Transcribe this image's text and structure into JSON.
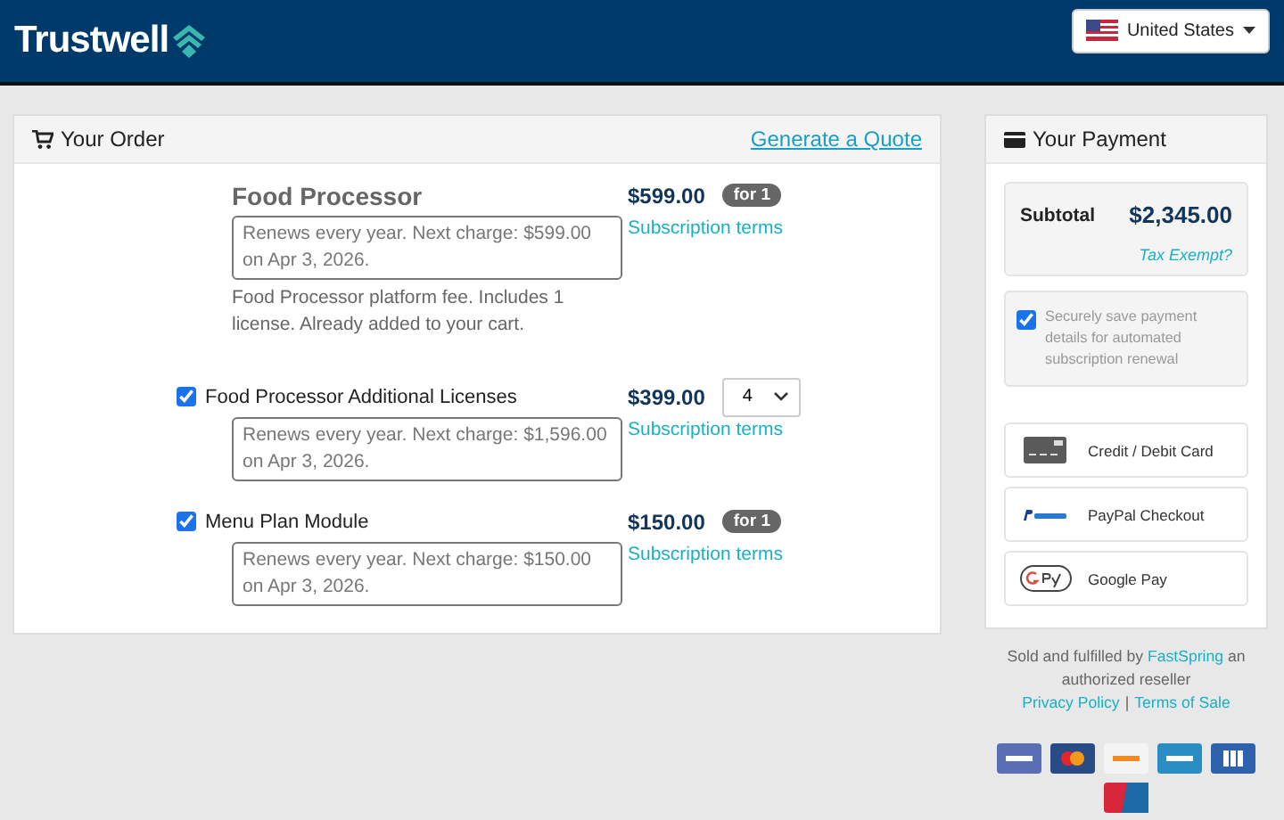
{
  "header": {
    "logo": "Trustwell",
    "country": "United States"
  },
  "order": {
    "title": "Your Order",
    "quote_link": "Generate a Quote",
    "items": [
      {
        "kind": "base",
        "name": "Food Processor",
        "renewal": "Renews every year. Next charge: $599.00 on Apr 3, 2026.",
        "note": "Food Processor platform fee. Includes 1 license. Already added to your cart.",
        "price": "$599.00",
        "quantity": {
          "kind": "badge",
          "text": "for 1"
        },
        "terms": "Subscription terms"
      },
      {
        "kind": "addon",
        "checked": true,
        "name": "Food Processor Additional Licenses",
        "renewal": "Renews every year. Next charge: $1,596.00 on Apr 3, 2026.",
        "price": "$399.00",
        "quantity": {
          "kind": "select",
          "text": "4"
        },
        "terms": "Subscription terms"
      },
      {
        "kind": "addon",
        "checked": true,
        "name": "Menu Plan Module",
        "renewal": "Renews every year. Next charge: $150.00 on Apr 3, 2026.",
        "price": "$150.00",
        "quantity": {
          "kind": "badge",
          "text": "for 1"
        },
        "terms": "Subscription terms"
      }
    ]
  },
  "payment": {
    "title": "Your Payment",
    "subtotal_label": "Subtotal",
    "subtotal": "$2,345.00",
    "tax_link": "Tax Exempt?",
    "save_details": {
      "checked": true,
      "label": "Securely save payment details for automated subscription renewal"
    },
    "methods": [
      {
        "kind": "card",
        "label": "Credit / Debit Card"
      },
      {
        "kind": "paypal",
        "label": "PayPal Checkout"
      },
      {
        "kind": "gpay",
        "label": "Google Pay"
      }
    ]
  },
  "footer": {
    "sold_by": "Sold and fulfilled by",
    "seller": "FastSpring",
    "sold_by_end": "an authorized reseller",
    "privacy": "Privacy Policy",
    "separator": "|",
    "terms": "Terms of Sale",
    "cards": [
      {
        "kind": "visa"
      },
      {
        "kind": "mastercard"
      },
      {
        "kind": "discover"
      },
      {
        "kind": "amex"
      },
      {
        "kind": "jcb"
      },
      {
        "kind": "unionpay"
      }
    ]
  }
}
